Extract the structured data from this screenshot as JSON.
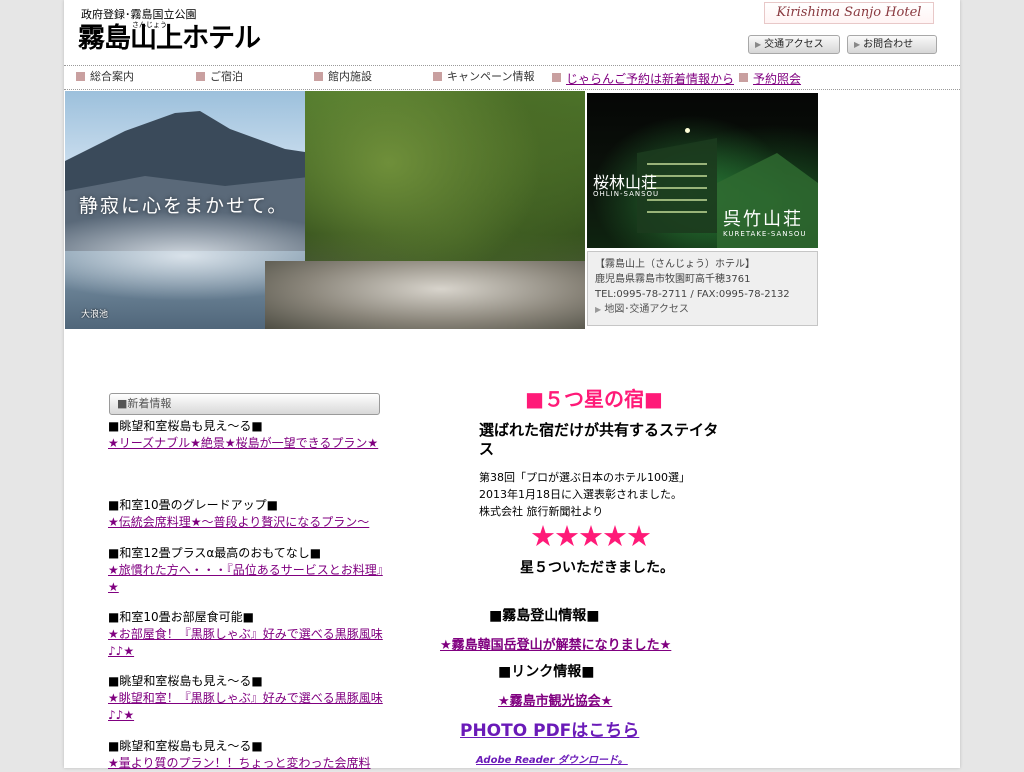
{
  "header": {
    "tagline": "政府登録･霧島国立公園",
    "logo_text": "霧島山上ホテル",
    "logo_ruby": "さんじょう",
    "brand": "Kirishima Sanjo Hotel",
    "access_button": "交通アクセス",
    "contact_button": "お問合わせ"
  },
  "nav": {
    "items": [
      {
        "label": "総合案内"
      },
      {
        "label": "ご宿泊"
      },
      {
        "label": "館内施設"
      },
      {
        "label": "キャンペーン情報"
      }
    ],
    "jalan_link": "じゃらんご予約は新着情報から",
    "reserve_link": "予約照会"
  },
  "hero": {
    "tagline": "静寂に心をまかせて。",
    "caption": "大浪池"
  },
  "night_photo": {
    "building1": "桜林山荘",
    "building1_sub": "OHLIN-SANSOU",
    "building2": "呉竹山荘",
    "building2_sub": "KURETAKE-SANSOU"
  },
  "info": {
    "name": "【霧島山上（さんじょう）ホテル】",
    "address": "鹿児島県霧島市牧園町高千穂3761",
    "phone": "TEL:0995-78-2711 / FAX:0995-78-2132",
    "map_link": "地図･交通アクセス"
  },
  "news": {
    "title": "■新着情報",
    "items": [
      {
        "head": "■眺望和室桜島も見え～る■",
        "link": "★リーズナブル★絶景★桜島が一望できるプラン★"
      },
      {
        "head": "■和室10畳のグレードアップ■",
        "link": "★伝統会席料理★～普段より贅沢になるプラン～"
      },
      {
        "head": "■和室12畳プラスα最高のおもてなし■",
        "link": "★旅慣れた方へ・・・『品位あるサービスとお料理』★"
      },
      {
        "head": "■和室10畳お部屋食可能■",
        "link": "★お部屋食！『黒豚しゃぶ』好みで選べる黒豚風味♪♪★"
      },
      {
        "head": "■眺望和室桜島も見え～る■",
        "link": "★眺望和室！『黒豚しゃぶ』好みで選べる黒豚風味♪♪★"
      },
      {
        "head": "■眺望和室桜島も見え～る■",
        "link": "★量より質のプラン！！ちょっと変わった会席料"
      }
    ]
  },
  "award": {
    "title": "■５つ星の宿■",
    "subtitle": "選ばれた宿だけが共有するステイタス",
    "line1": "第38回「プロが選ぶ日本のホテル100選」",
    "line2": "2013年1月18日に入選表彰されました。",
    "line3": "株式会社 旅行新聞社より",
    "stars": "★★★★★",
    "rating_text": "　　　星５ついただきました。"
  },
  "climb": {
    "title": "■霧島登山情報■",
    "link": "★霧島韓国岳登山が解禁になりました★"
  },
  "links": {
    "title": "■リンク情報■",
    "tourism": "★霧島市観光協会★"
  },
  "photo_pdf": "PHOTO PDFはこちら",
  "adobe": "Adobe Reader ダウンロード。"
}
